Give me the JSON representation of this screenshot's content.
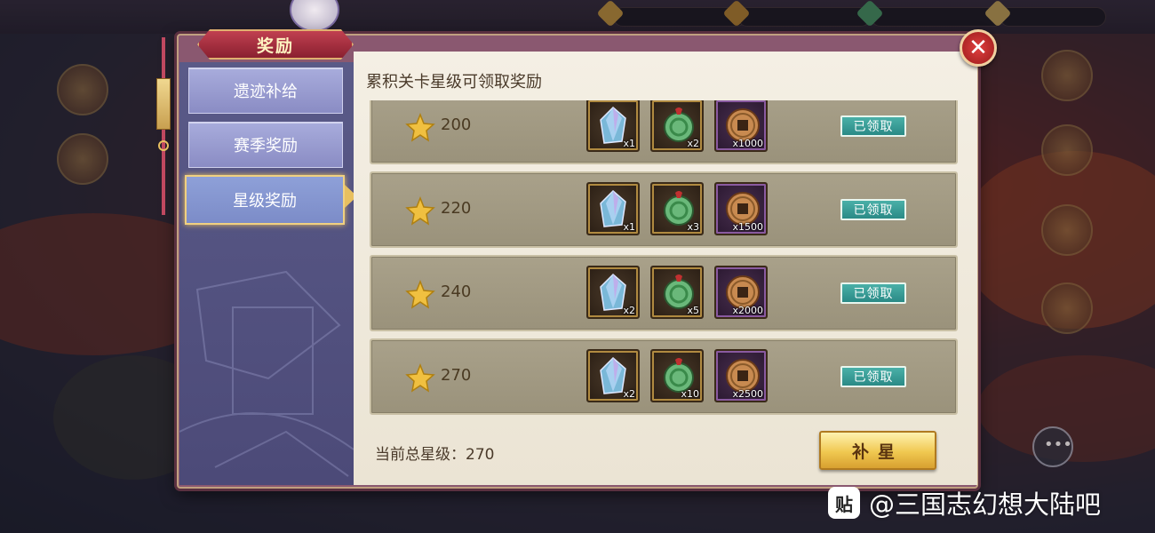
{
  "panel": {
    "title": "奖励"
  },
  "sidebar": {
    "tabs": [
      {
        "label": "遗迹补给"
      },
      {
        "label": "赛季奖励"
      },
      {
        "label": "星级奖励"
      }
    ],
    "active_index": 2
  },
  "content": {
    "title": "累积关卡星级可领取奖励",
    "rows": [
      {
        "stars": "200",
        "items": [
          {
            "name": "crystal",
            "qty": "x1"
          },
          {
            "name": "jade-pendant",
            "qty": "x2"
          },
          {
            "name": "copper-coin",
            "qty": "x1000"
          }
        ],
        "status": "已领取"
      },
      {
        "stars": "220",
        "items": [
          {
            "name": "crystal",
            "qty": "x1"
          },
          {
            "name": "jade-pendant",
            "qty": "x3"
          },
          {
            "name": "copper-coin",
            "qty": "x1500"
          }
        ],
        "status": "已领取"
      },
      {
        "stars": "240",
        "items": [
          {
            "name": "crystal",
            "qty": "x2"
          },
          {
            "name": "jade-pendant",
            "qty": "x5"
          },
          {
            "name": "copper-coin",
            "qty": "x2000"
          }
        ],
        "status": "已领取"
      },
      {
        "stars": "270",
        "items": [
          {
            "name": "crystal",
            "qty": "x2"
          },
          {
            "name": "jade-pendant",
            "qty": "x10"
          },
          {
            "name": "copper-coin",
            "qty": "x2500"
          }
        ],
        "status": "已领取"
      }
    ],
    "total_label": "当前总星级：270",
    "supplement_button": "补星"
  },
  "close_icon": "close-x-icon",
  "watermark": {
    "logo": "贴",
    "text": "@三国志幻想大陆吧"
  },
  "colors": {
    "claimed": "#2a8a86",
    "row_bg": "#a9a18a",
    "sidebar": "#5a5a88",
    "accent_gold": "#e8c060"
  }
}
